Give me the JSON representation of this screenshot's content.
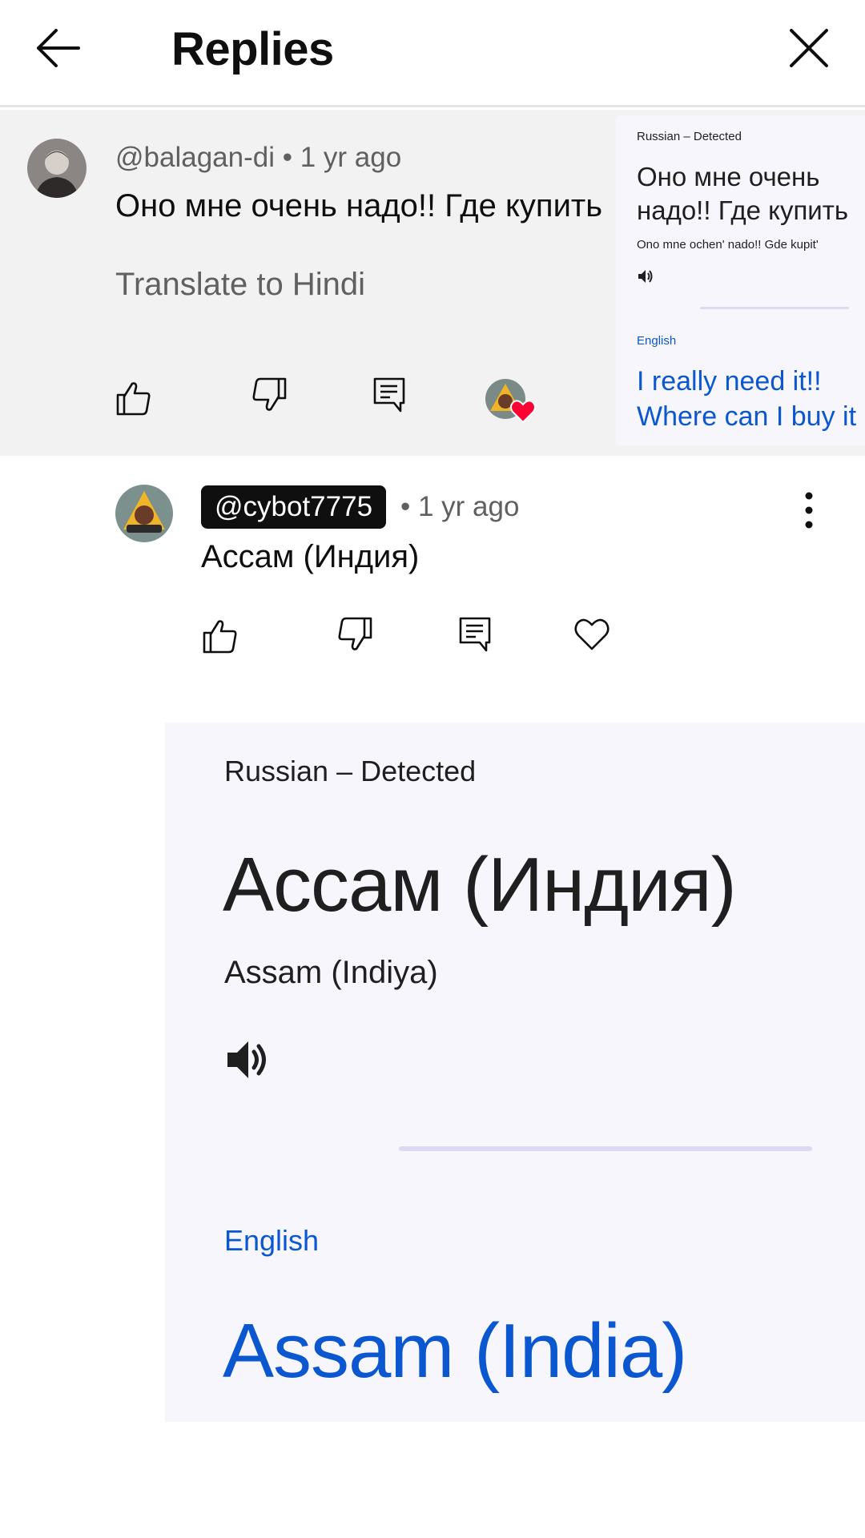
{
  "header": {
    "title": "Replies",
    "back_icon": "arrow-left-icon",
    "close_icon": "close-icon"
  },
  "parent_comment": {
    "meta": "@balagan-di • 1 yr ago",
    "text": "Оно мне очень надо!! Где купить",
    "translate_link": "Translate to Hindi",
    "actions": [
      "like-icon",
      "dislike-icon",
      "reply-icon"
    ],
    "creator_heart_color": "#ff0033"
  },
  "mini_translation": {
    "source_language": "Russian – Detected",
    "source_line1": "Оно мне очень",
    "source_line2": "надо!! Где купить",
    "transliteration": "Ono mne ochen' nado!! Gde kupit'",
    "target_language": "English",
    "target_line1": "I really need it!!",
    "target_line2": "Where can I buy it"
  },
  "reply": {
    "handle": "@cybot7775",
    "time": "• 1 yr ago",
    "text": "Ассам (Индия)",
    "actions": [
      "like-icon",
      "dislike-icon",
      "reply-icon",
      "heart-icon"
    ]
  },
  "translation_panel": {
    "source_language": "Russian – Detected",
    "source_text": "Ассам (Индия)",
    "transliteration": "Assam (Indiya)",
    "target_language": "English",
    "target_text": "Assam (India)",
    "accent_color": "#0b57d0"
  }
}
